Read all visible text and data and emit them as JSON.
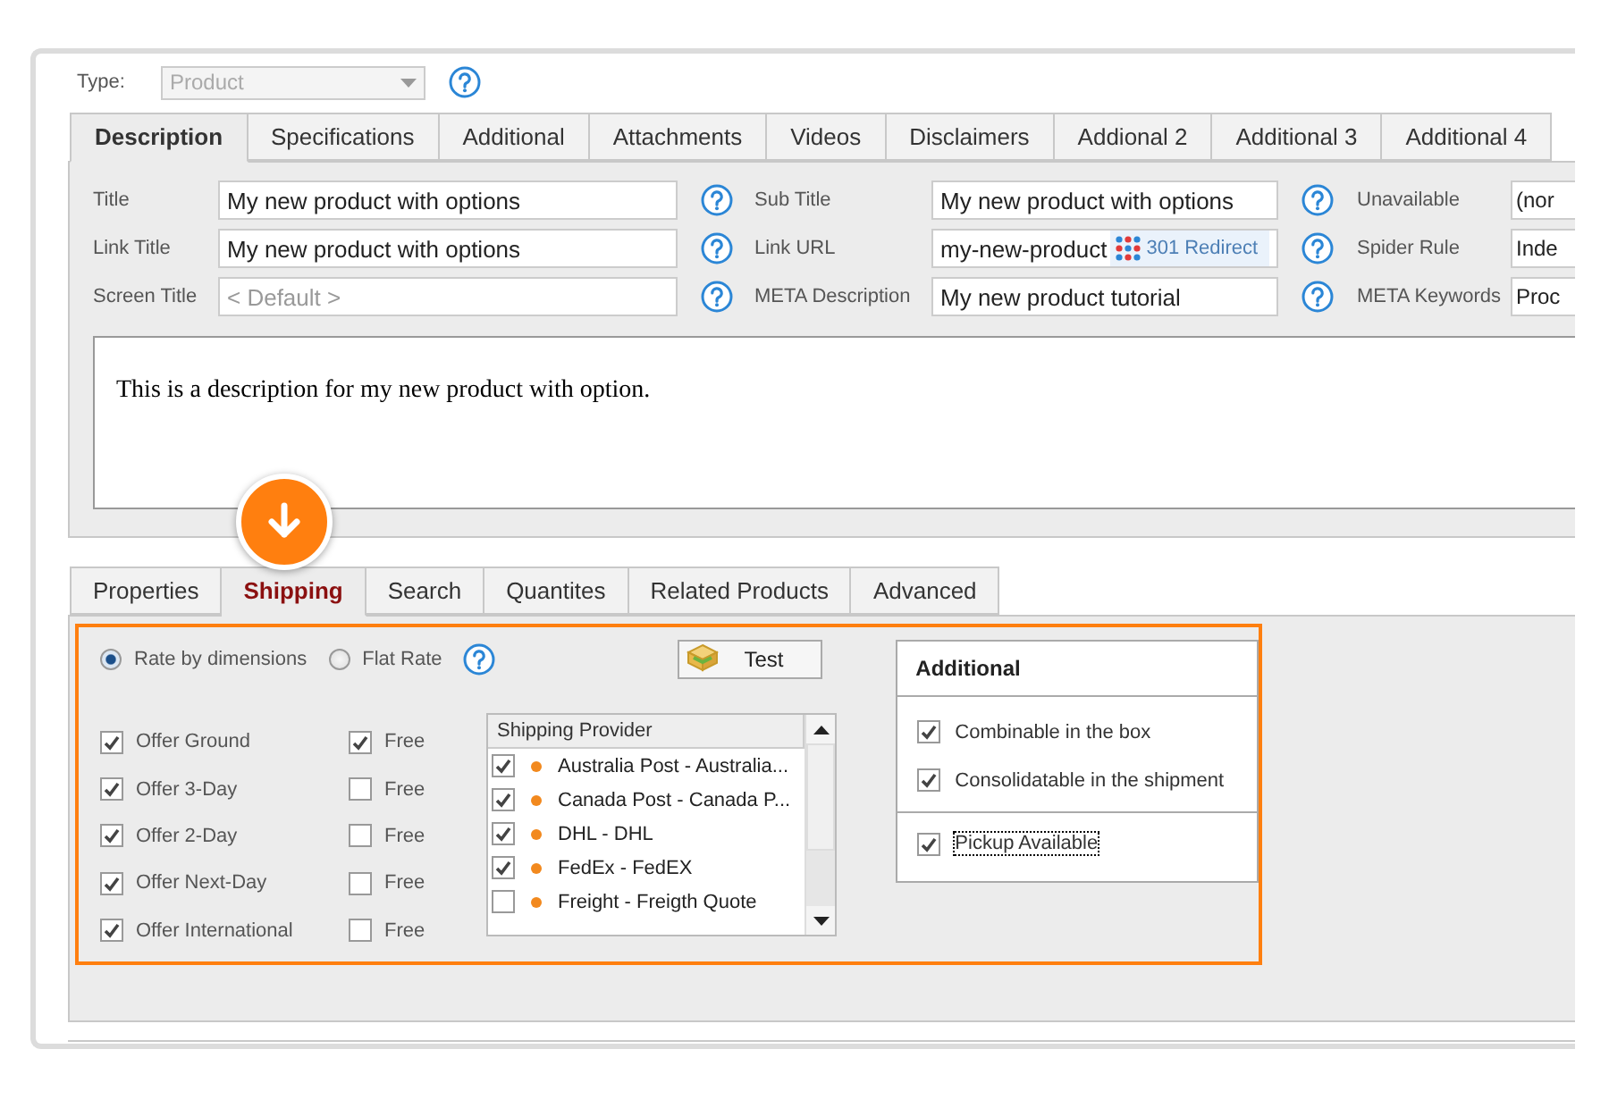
{
  "type_field": {
    "label": "Type:",
    "value": "Product",
    "disabled": true
  },
  "top_tabs": [
    {
      "label": "Description",
      "selected": true
    },
    {
      "label": "Specifications",
      "selected": false
    },
    {
      "label": "Additional",
      "selected": false
    },
    {
      "label": "Attachments",
      "selected": false
    },
    {
      "label": "Videos",
      "selected": false
    },
    {
      "label": "Disclaimers",
      "selected": false
    },
    {
      "label": "Addional 2",
      "selected": false
    },
    {
      "label": "Additional 3",
      "selected": false
    },
    {
      "label": "Additional 4",
      "selected": false
    }
  ],
  "fields": [
    {
      "label": "Title",
      "kind": "text",
      "value": "My new product with options"
    },
    {
      "label": "Sub Title",
      "kind": "text",
      "value": "My new product with options"
    },
    {
      "label": "Unavailable",
      "kind": "cut",
      "value": "(nor"
    },
    {
      "label": "Link Title",
      "kind": "text",
      "value": "My new product with options"
    },
    {
      "label": "Link URL",
      "kind": "redirect",
      "value": "my-new-product",
      "badge": "301 Redirect"
    },
    {
      "label": "Spider Rule",
      "kind": "cut",
      "value": "Inde"
    },
    {
      "label": "Screen Title",
      "kind": "text",
      "placeholder": "< Default >"
    },
    {
      "label": "META Description",
      "kind": "text",
      "value": "My new product tutorial"
    },
    {
      "label": "META Keywords",
      "kind": "cut",
      "value": "Proc"
    }
  ],
  "description": "This is a description for my new product with option.",
  "bottom_tabs": [
    {
      "label": "Properties",
      "selected": false
    },
    {
      "label": "Shipping",
      "selected": true
    },
    {
      "label": "Search",
      "selected": false
    },
    {
      "label": "Quantites",
      "selected": false
    },
    {
      "label": "Related Products",
      "selected": false
    },
    {
      "label": "Advanced",
      "selected": false
    }
  ],
  "shipping": {
    "rate_options": [
      {
        "label": "Rate by dimensions",
        "selected": true
      },
      {
        "label": "Flat Rate",
        "selected": false
      }
    ],
    "test_button": "Test",
    "offers": [
      {
        "label": "Offer Ground",
        "checked": true,
        "free": {
          "label": "Free",
          "checked": true
        }
      },
      {
        "label": "Offer 3-Day",
        "checked": true,
        "free": {
          "label": "Free",
          "checked": false
        }
      },
      {
        "label": "Offer 2-Day",
        "checked": true,
        "free": {
          "label": "Free",
          "checked": false
        }
      },
      {
        "label": "Offer Next-Day",
        "checked": true,
        "free": {
          "label": "Free",
          "checked": false
        }
      },
      {
        "label": "Offer International",
        "checked": true,
        "free": {
          "label": "Free",
          "checked": false
        }
      }
    ],
    "provider_list": {
      "header": "Shipping Provider",
      "items": [
        {
          "label": "Australia Post - Australia...",
          "checked": true
        },
        {
          "label": "Canada Post - Canada P...",
          "checked": true
        },
        {
          "label": "DHL - DHL",
          "checked": true
        },
        {
          "label": "FedEx - FedEX",
          "checked": true
        },
        {
          "label": "Freight - Freigth Quote",
          "checked": false
        }
      ]
    },
    "additional": {
      "title": "Additional",
      "groups": [
        [
          {
            "label": "Combinable in the box",
            "checked": true,
            "focused": false
          },
          {
            "label": "Consolidatable in the shipment",
            "checked": true,
            "focused": false
          }
        ],
        [
          {
            "label": "Pickup Available",
            "checked": true,
            "focused": true
          }
        ]
      ]
    }
  }
}
